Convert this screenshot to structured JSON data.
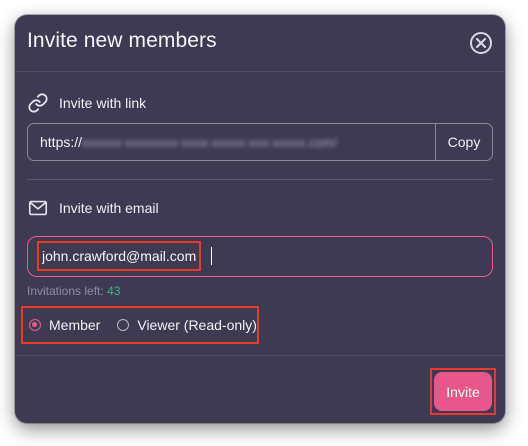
{
  "dialog": {
    "title": "Invite new members",
    "close_icon": "close-circle-icon"
  },
  "link_section": {
    "label": "Invite with link",
    "icon": "link-icon",
    "url_prefix": "https://",
    "url_blurred": "xxxxxx-xxxxxxxx-xxxx-xxxxx-xxx-xxxxx.com/",
    "copy_label": "Copy"
  },
  "email_section": {
    "label": "Invite with email",
    "icon": "envelope-icon",
    "email_value": "john.crawford@mail.com",
    "invitations_left_label": "Invitations left:",
    "invitations_left_count": "43"
  },
  "roles": {
    "selected": "Member",
    "options": [
      {
        "label": "Member",
        "checked": true
      },
      {
        "label": "Viewer (Read-only)",
        "checked": false
      }
    ]
  },
  "footer": {
    "invite_label": "Invite"
  },
  "colors": {
    "background": "#3d3a52",
    "accent": "#e9568a",
    "highlight": "#e8392a",
    "count": "#3fb58a"
  }
}
